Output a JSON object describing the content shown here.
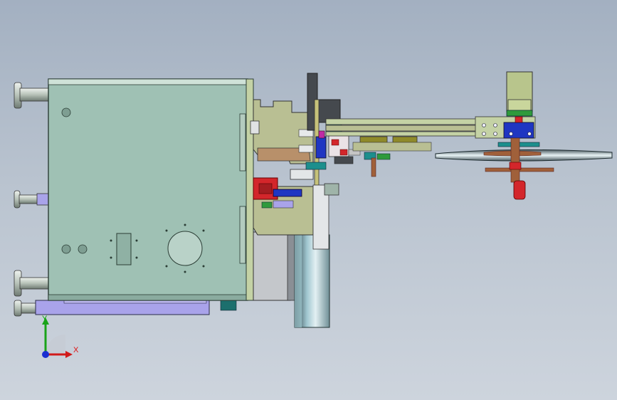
{
  "viewport": {
    "background_top": "#a3b0c1",
    "background_bottom": "#cdd4dd"
  },
  "model": {
    "colors": {
      "housing": "#9fc1b4",
      "housing_edge": "#2b3d35",
      "flange": "#c4d2a5",
      "olive": "#b9bf93",
      "dark_plate": "#45494e",
      "silver": "#c8ccd0",
      "lavender": "#a9a3ea",
      "red": "#d3262b",
      "blue": "#1f36c2",
      "teal": "#1c8f8d",
      "green": "#2f9a3c",
      "brown": "#a0603a",
      "yellow_olive": "#8f8a2a",
      "motor_body": "#b8c58c",
      "wheel": "#cfe0e6"
    }
  },
  "triad": {
    "x_label": "X",
    "y_label": "Y",
    "x_color": "#d11a1a",
    "y_color": "#19a319",
    "z_color": "#1a2fd1"
  }
}
